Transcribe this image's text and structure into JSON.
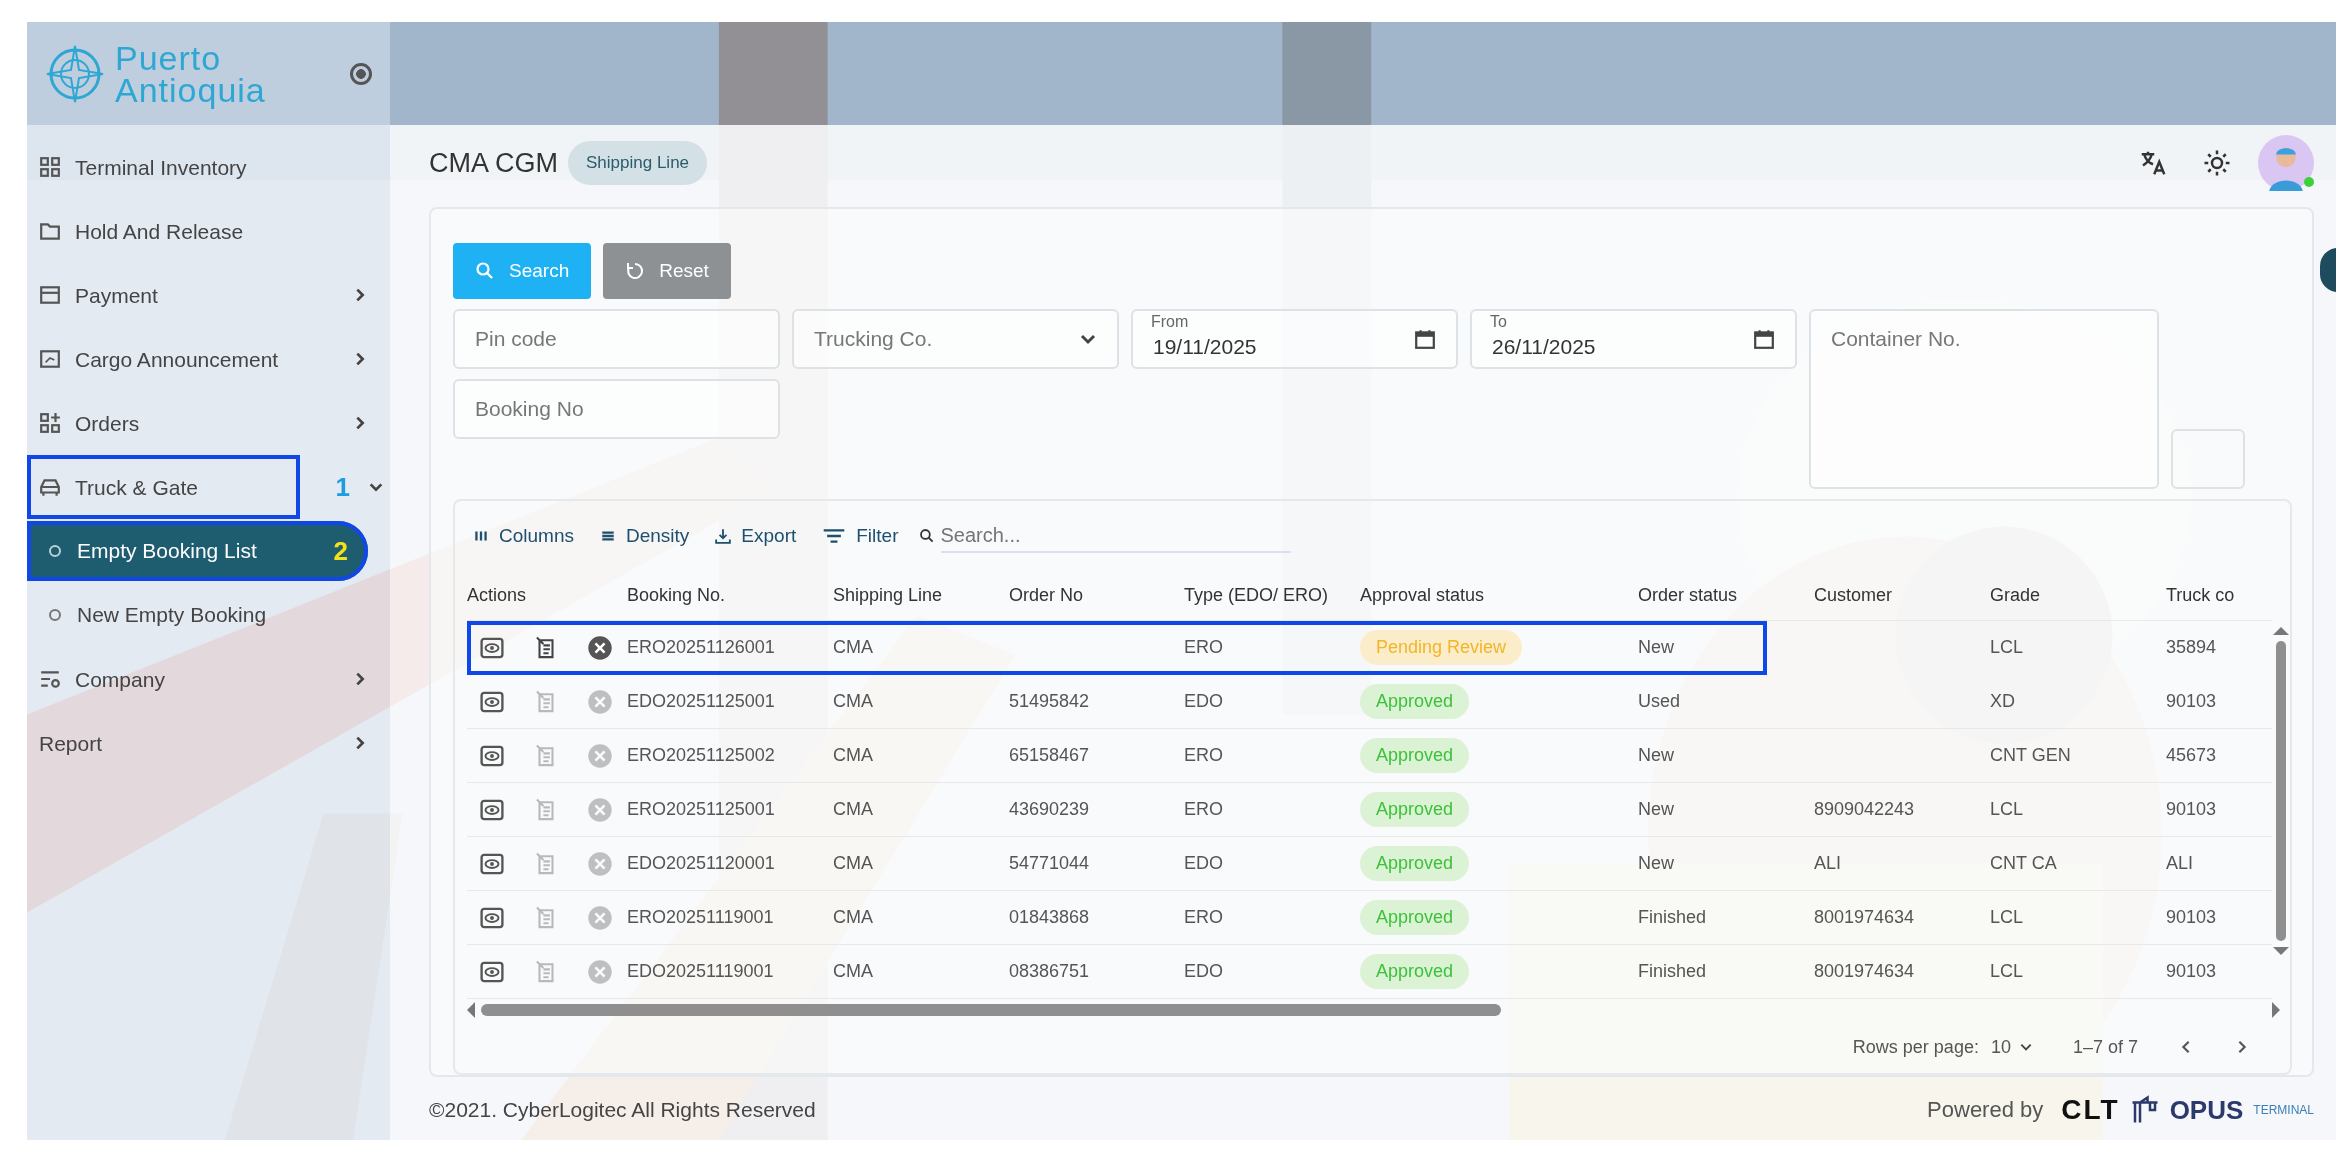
{
  "brand": {
    "line1": "Puerto",
    "line2": "Antioquia"
  },
  "sidebar": {
    "items": [
      {
        "label": "Terminal Inventory"
      },
      {
        "label": "Hold And Release"
      },
      {
        "label": "Payment",
        "expanded": false
      },
      {
        "label": "Cargo Announcement",
        "expanded": false
      },
      {
        "label": "Orders",
        "expanded": false
      },
      {
        "label": "Truck & Gate",
        "expanded": true,
        "annotation": "1",
        "children": [
          {
            "label": "Empty Booking List",
            "selected": true,
            "annotation": "2"
          },
          {
            "label": "New Empty Booking",
            "selected": false
          }
        ]
      },
      {
        "label": "Company",
        "expanded": false
      },
      {
        "label": "Report",
        "expanded": false
      }
    ]
  },
  "header": {
    "company": "CMA CGM",
    "role_badge": "Shipping Line"
  },
  "filters": {
    "search_button": "Search",
    "reset_button": "Reset",
    "pin_code": {
      "placeholder": "Pin code"
    },
    "trucking_co": {
      "placeholder": "Trucking Co."
    },
    "from": {
      "label": "From",
      "value": "19/11/2025"
    },
    "to": {
      "label": "To",
      "value": "26/11/2025"
    },
    "container_no": {
      "placeholder": "Container No."
    },
    "booking_no": {
      "placeholder": "Booking No"
    }
  },
  "table": {
    "toolbar": [
      "Columns",
      "Density",
      "Export",
      "Filter"
    ],
    "search": {
      "placeholder": "Search..."
    },
    "columns": [
      "Actions",
      "Booking No.",
      "Shipping Line",
      "Order No",
      "Type (EDO/ ERO)",
      "Approval status",
      "Order status",
      "Customer",
      "Grade",
      "Truck co"
    ],
    "rows": [
      {
        "highlighted": true,
        "actions_enabled": true,
        "booking": "ERO20251126001",
        "line": "CMA",
        "order": "",
        "type": "ERO",
        "approval": {
          "text": "Pending Review",
          "kind": "pending"
        },
        "order_status": "New",
        "customer": "",
        "grade": "LCL",
        "truck": "35894"
      },
      {
        "highlighted": false,
        "actions_enabled": false,
        "booking": "EDO20251125001",
        "line": "CMA",
        "order": "51495842",
        "type": "EDO",
        "approval": {
          "text": "Approved",
          "kind": "approved"
        },
        "order_status": "Used",
        "customer": "",
        "grade": "XD",
        "truck": "90103"
      },
      {
        "highlighted": false,
        "actions_enabled": false,
        "booking": "ERO20251125002",
        "line": "CMA",
        "order": "65158467",
        "type": "ERO",
        "approval": {
          "text": "Approved",
          "kind": "approved"
        },
        "order_status": "New",
        "customer": "",
        "grade": "CNT GEN",
        "truck": "45673"
      },
      {
        "highlighted": false,
        "actions_enabled": false,
        "booking": "ERO20251125001",
        "line": "CMA",
        "order": "43690239",
        "type": "ERO",
        "approval": {
          "text": "Approved",
          "kind": "approved"
        },
        "order_status": "New",
        "customer": "8909042243",
        "grade": "LCL",
        "truck": "90103"
      },
      {
        "highlighted": false,
        "actions_enabled": false,
        "booking": "EDO20251120001",
        "line": "CMA",
        "order": "54771044",
        "type": "EDO",
        "approval": {
          "text": "Approved",
          "kind": "approved"
        },
        "order_status": "New",
        "customer": "ALI",
        "grade": "CNT CA",
        "truck": "ALI"
      },
      {
        "highlighted": false,
        "actions_enabled": false,
        "booking": "ERO20251119001",
        "line": "CMA",
        "order": "01843868",
        "type": "ERO",
        "approval": {
          "text": "Approved",
          "kind": "approved"
        },
        "order_status": "Finished",
        "customer": "8001974634",
        "grade": "LCL",
        "truck": "90103"
      },
      {
        "highlighted": false,
        "actions_enabled": false,
        "booking": "EDO20251119001",
        "line": "CMA",
        "order": "08386751",
        "type": "EDO",
        "approval": {
          "text": "Approved",
          "kind": "approved"
        },
        "order_status": "Finished",
        "customer": "8001974634",
        "grade": "LCL",
        "truck": "90103"
      }
    ],
    "pagination": {
      "rows_label": "Rows per page:",
      "rows_value": "10",
      "range": "1–7 of 7"
    }
  },
  "footer": {
    "copyright": "©2021. CyberLogitec All Rights Reserved",
    "powered_by": "Powered by",
    "logo_1": "CLT",
    "logo_2": "OPUS",
    "logo_3": "TERMINAL"
  }
}
